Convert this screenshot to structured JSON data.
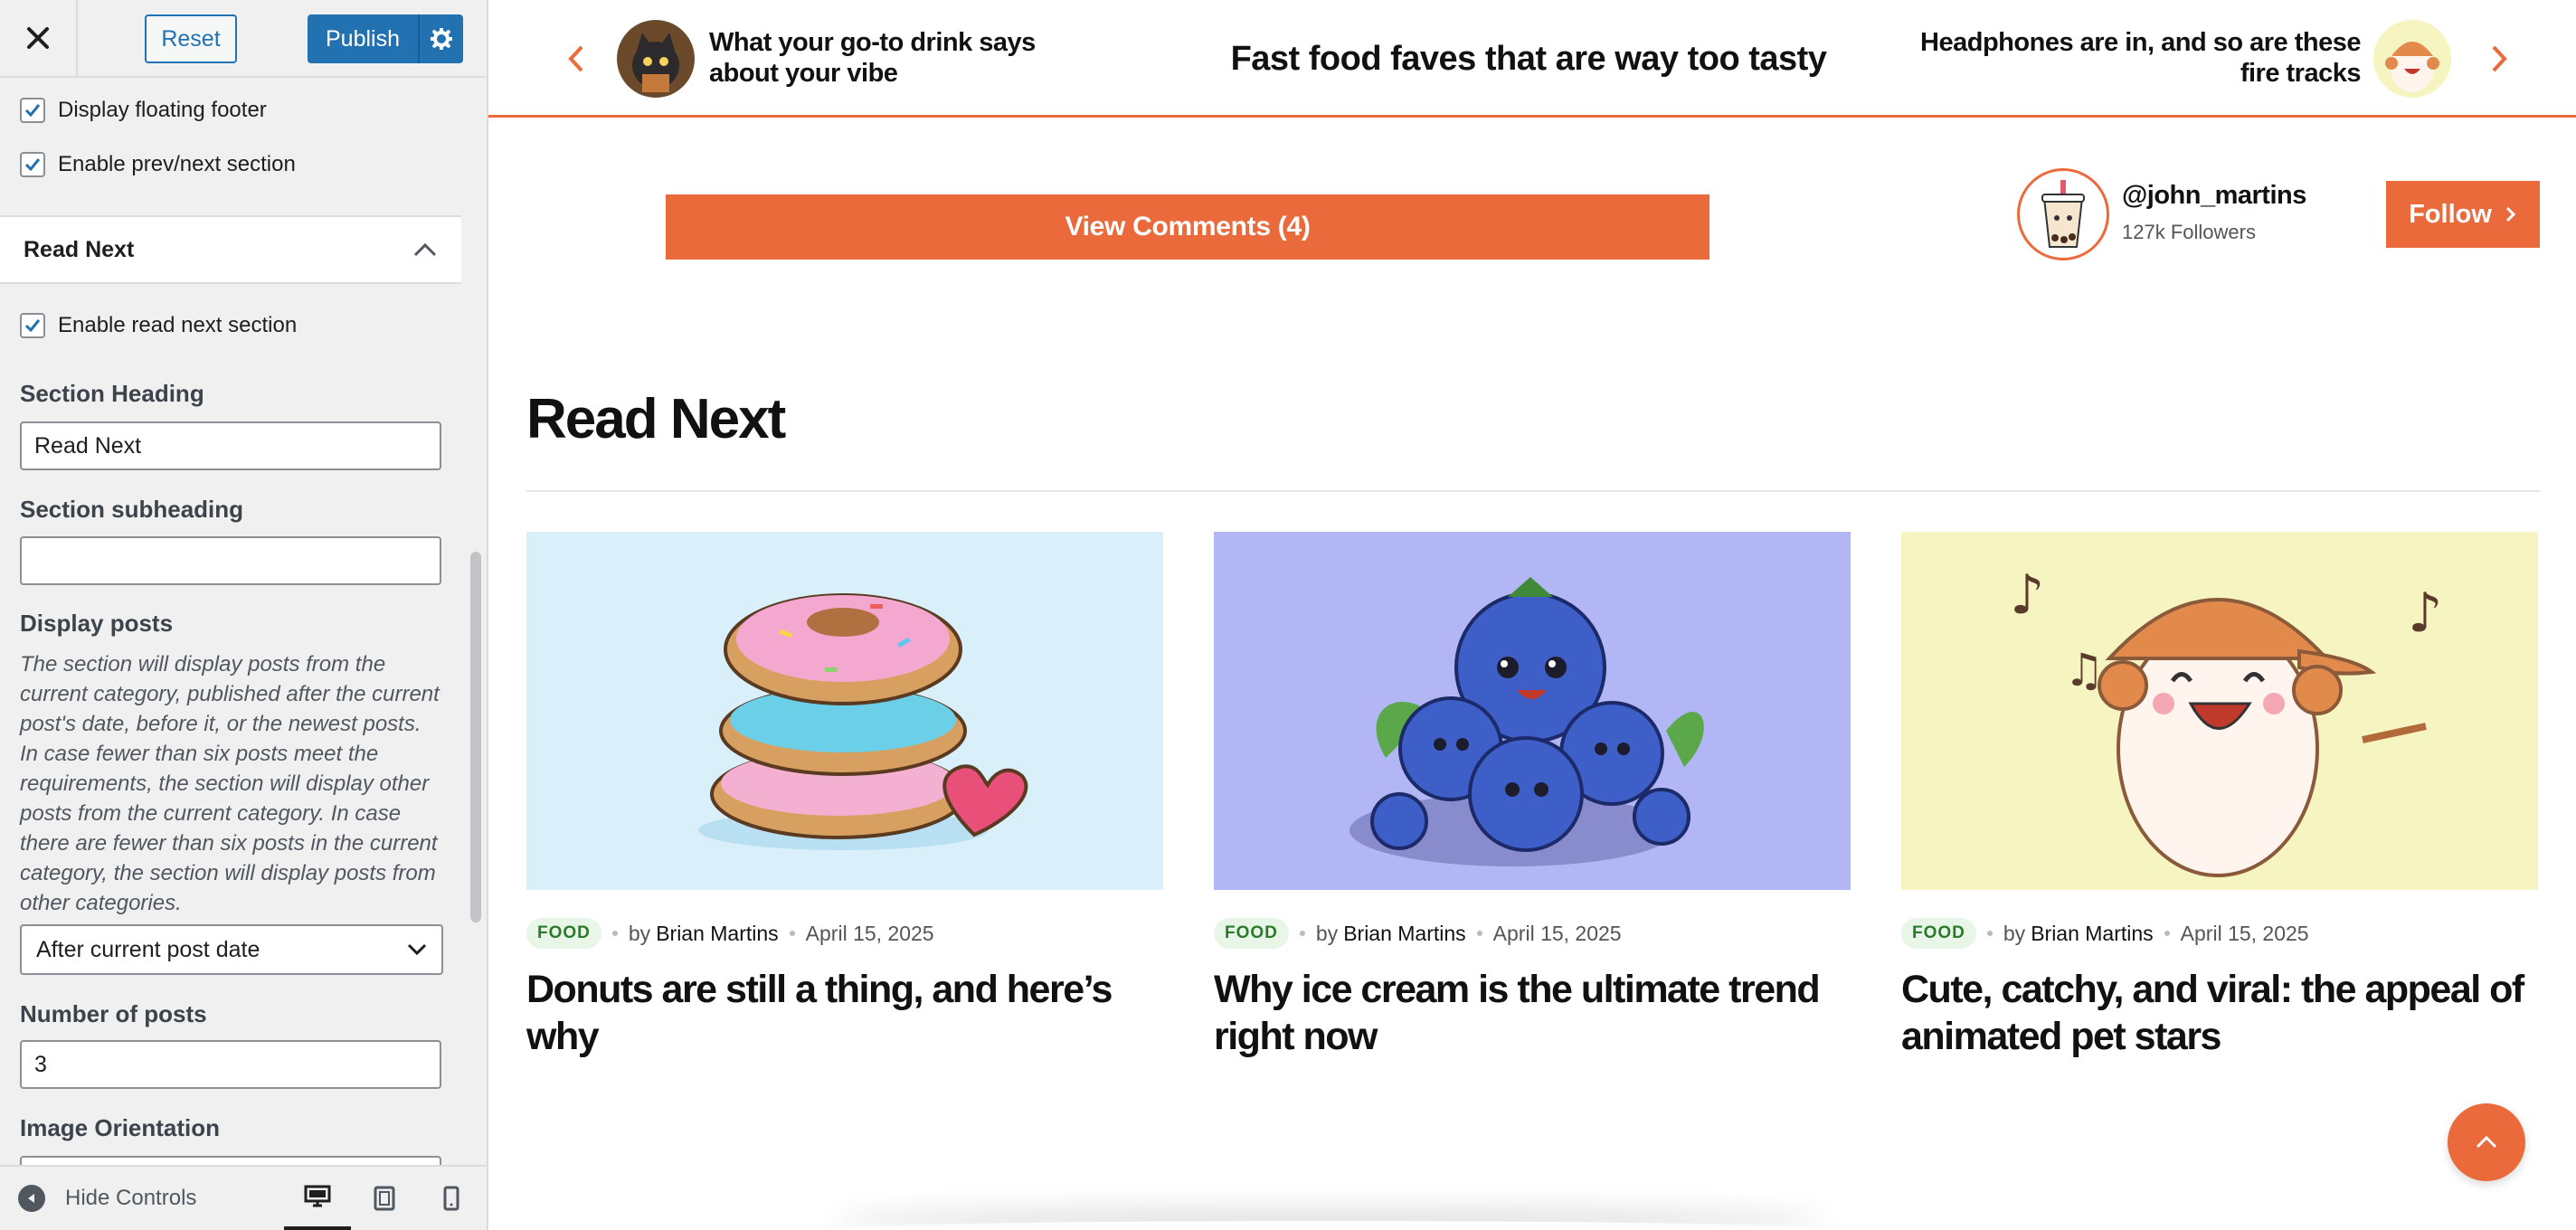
{
  "customizer": {
    "header": {
      "reset_label": "Reset",
      "publish_label": "Publish"
    },
    "options": {
      "floating_footer": {
        "label": "Display floating footer",
        "checked": true
      },
      "prev_next": {
        "label": "Enable prev/next section",
        "checked": true
      }
    },
    "section": {
      "title": "Read Next",
      "enable_checkbox": {
        "label": "Enable read next section",
        "checked": true
      },
      "section_heading": {
        "label": "Section Heading",
        "value": "Read Next"
      },
      "section_subheading": {
        "label": "Section subheading",
        "value": ""
      },
      "display_posts": {
        "label": "Display posts",
        "description": "The section will display posts from the current category, published after the current post's date, before it, or the newest posts. In case fewer than six posts meet the requirements, the section will display other posts from the current category. In case there are fewer than six posts in the current category, the section will display posts from other categories.",
        "selected": "After current post date"
      },
      "number_of_posts": {
        "label": "Number of posts",
        "value": "3"
      },
      "image_orientation": {
        "label": "Image Orientation"
      }
    },
    "footer": {
      "hide_controls_label": "Hide Controls",
      "active_device": "desktop"
    }
  },
  "preview": {
    "accent_color": "#ea6a3c",
    "nav": {
      "prev_title": "What your go-to drink says about your vibe",
      "center_title": "Fast food faves that are way too tasty",
      "next_title": "Headphones are in, and so are these fire tracks"
    },
    "comments_button_label": "View Comments (4)",
    "author": {
      "handle": "@john_martins",
      "followers": "127k Followers",
      "follow_label": "Follow"
    },
    "read_next": {
      "heading": "Read Next",
      "posts": [
        {
          "category": "FOOD",
          "by": "by",
          "author": "Brian Martins",
          "date": "April 15, 2025",
          "title": "Donuts are still a thing, and here’s why",
          "image_bg": "#d9f0fb"
        },
        {
          "category": "FOOD",
          "by": "by",
          "author": "Brian Martins",
          "date": "April 15, 2025",
          "title": "Why ice cream is the ultimate trend right now",
          "image_bg": "#b3b6f4"
        },
        {
          "category": "FOOD",
          "by": "by",
          "author": "Brian Martins",
          "date": "April 15, 2025",
          "title": "Cute, catchy, and viral: the appeal of animated pet stars",
          "image_bg": "#f6f4c0"
        }
      ]
    }
  }
}
